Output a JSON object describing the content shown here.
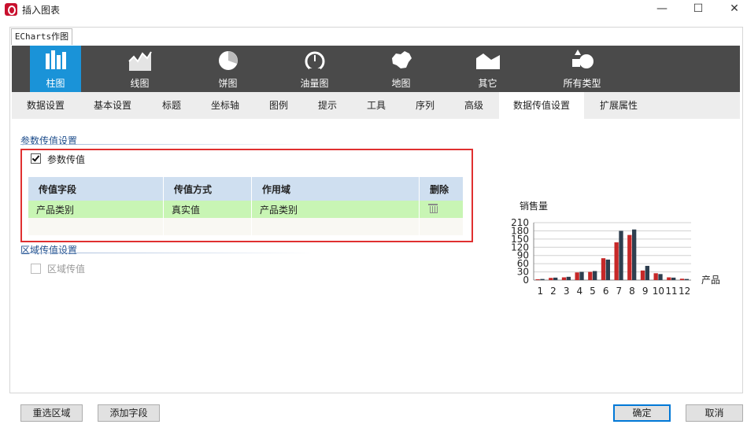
{
  "window": {
    "title": "插入图表",
    "minimize": "—",
    "maximize": "☐",
    "close": "✕"
  },
  "echarts_tab": "ECharts作图",
  "chart_types": [
    {
      "label": "柱图",
      "icon": "bar-chart-icon"
    },
    {
      "label": "线图",
      "icon": "line-chart-icon"
    },
    {
      "label": "饼图",
      "icon": "pie-chart-icon"
    },
    {
      "label": "油量图",
      "icon": "gauge-icon"
    },
    {
      "label": "地图",
      "icon": "map-icon"
    },
    {
      "label": "其它",
      "icon": "other-chart-icon"
    },
    {
      "label": "所有类型",
      "icon": "all-types-icon"
    }
  ],
  "settings_tabs": [
    "数据设置",
    "基本设置",
    "标题",
    "坐标轴",
    "图例",
    "提示",
    "工具",
    "序列",
    "高级",
    "数据传值设置",
    "扩展属性"
  ],
  "active_tab": "数据传值设置",
  "param_section": {
    "title": "参数传值设置",
    "checkbox_label": "参数传值",
    "checked": true,
    "columns": [
      "传值字段",
      "传值方式",
      "作用域",
      "删除"
    ],
    "rows": [
      {
        "field": "产品类别",
        "method": "真实值",
        "scope": "产品类别",
        "delete_icon": "trash-icon"
      }
    ]
  },
  "region_section": {
    "title": "区域传值设置",
    "checkbox_label": "区域传值",
    "checked": false
  },
  "preview_chart_text": {
    "ylabel": "销售量",
    "xlabel": "产品"
  },
  "chart_data": {
    "type": "bar",
    "ylabel": "销售量",
    "xlabel": "产品类别",
    "categories": [
      "1",
      "2",
      "3",
      "4",
      "5",
      "6",
      "7",
      "8",
      "9",
      "10",
      "11",
      "12"
    ],
    "ylim": [
      0,
      210
    ],
    "yticks": [
      0,
      30,
      60,
      90,
      120,
      150,
      180,
      210
    ],
    "grid": true,
    "colors": [
      "#c62828",
      "#2e3f4f"
    ],
    "series": [
      {
        "values": [
          3,
          8,
          10,
          28,
          30,
          80,
          138,
          165,
          35,
          25,
          10,
          5
        ]
      },
      {
        "values": [
          4,
          9,
          12,
          30,
          33,
          75,
          180,
          185,
          52,
          22,
          9,
          4
        ]
      }
    ]
  },
  "buttons": {
    "reselect": "重选区域",
    "add_field": "添加字段",
    "ok": "确定",
    "cancel": "取消"
  }
}
